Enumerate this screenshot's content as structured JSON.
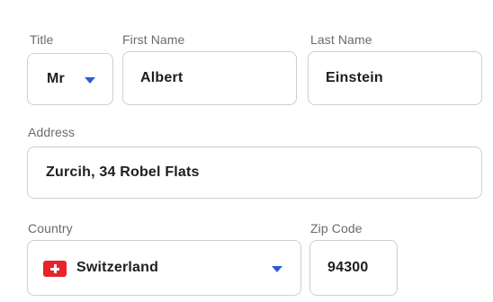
{
  "form": {
    "title": {
      "label": "Title",
      "value": "Mr"
    },
    "first_name": {
      "label": "First Name",
      "value": "Albert"
    },
    "last_name": {
      "label": "Last Name",
      "value": "Einstein"
    },
    "address": {
      "label": "Address",
      "value": "Zurcih, 34 Robel Flats"
    },
    "country": {
      "label": "Country",
      "value": "Switzerland",
      "flag_icon": "swiss-flag-icon"
    },
    "zip_code": {
      "label": "Zip Code",
      "value": "94300"
    }
  },
  "colors": {
    "caret": "#2f5bd3",
    "flag_red": "#e8232a",
    "border": "#cfcfcf",
    "label": "#6b6b6b",
    "value": "#1e1e1e"
  }
}
